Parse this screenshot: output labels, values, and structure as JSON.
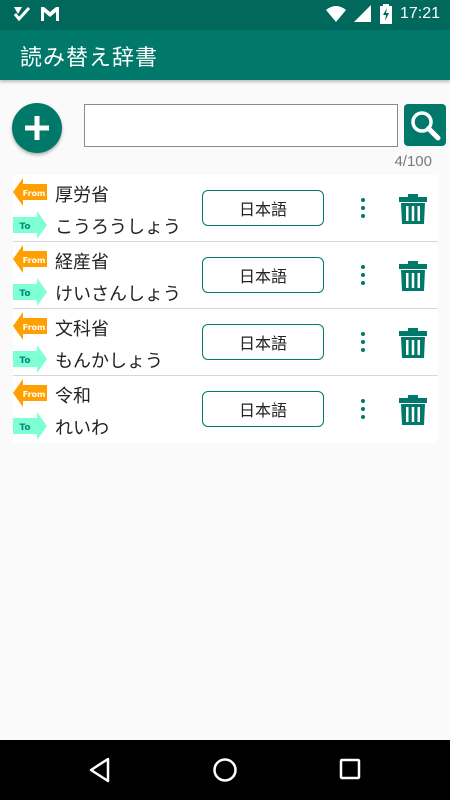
{
  "status_bar": {
    "time": "17:21",
    "icons": [
      "notification-check-icon",
      "gmail-icon",
      "wifi-icon",
      "signal-icon",
      "battery-icon"
    ]
  },
  "app_bar": {
    "title": "読み替え辞書"
  },
  "toolbar": {
    "add_icon": "plus-icon",
    "search": {
      "value": "",
      "placeholder": ""
    },
    "search_icon": "search-icon"
  },
  "count": "4/100",
  "entries": [
    {
      "from_tag": "From",
      "to_tag": "To",
      "from": "厚労省",
      "to": "こうろうしょう",
      "language": "日本語"
    },
    {
      "from_tag": "From",
      "to_tag": "To",
      "from": "経産省",
      "to": "けいさんしょう",
      "language": "日本語"
    },
    {
      "from_tag": "From",
      "to_tag": "To",
      "from": "文科省",
      "to": "もんかしょう",
      "language": "日本語"
    },
    {
      "from_tag": "From",
      "to_tag": "To",
      "from": "令和",
      "to": "れいわ",
      "language": "日本語"
    }
  ],
  "nav_bar": {
    "icons": [
      "back-icon",
      "home-icon",
      "recents-icon"
    ]
  },
  "colors": {
    "primary": "#00796b",
    "primary_dark": "#00695c",
    "from_tag": "#ffa000",
    "to_tag": "#7fffd4"
  }
}
